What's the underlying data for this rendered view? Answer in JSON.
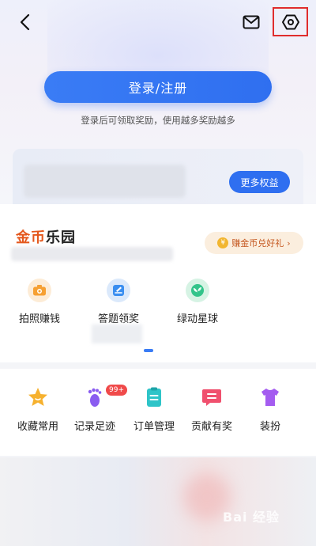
{
  "header": {
    "back_icon": "back-arrow-icon",
    "mail_icon": "mail-icon",
    "settings_icon": "settings-hexagon-icon",
    "highlight_color": "#e02d2d"
  },
  "login": {
    "button_label": "登录/注册",
    "subtitle": "登录后可领取奖励，使用越多奖励越多",
    "accent": "#2f6ff0"
  },
  "rights": {
    "more_label": "更多权益"
  },
  "coin_park": {
    "title_part1": "金币",
    "title_part2": "乐园",
    "exchange_coin_glyph": "¥",
    "exchange_label": "赚金币兑好礼",
    "exchange_chevron": "›",
    "features": [
      {
        "label": "拍照赚钱",
        "icon": "camera-icon",
        "color": "#f6a032"
      },
      {
        "label": "答题领奖",
        "icon": "quiz-icon",
        "color": "#3a8ef0"
      },
      {
        "label": "绿动星球",
        "icon": "leaf-planet-icon",
        "color": "#32c48a"
      }
    ]
  },
  "tools": {
    "items": [
      {
        "label": "收藏常用",
        "icon": "star-icon",
        "color": "#f6b12e"
      },
      {
        "label": "记录足迹",
        "icon": "footprint-icon",
        "color": "#8a5cf0"
      },
      {
        "label": "订单管理",
        "icon": "clipboard-icon",
        "color": "#2ec4c8"
      },
      {
        "label": "贡献有奖",
        "icon": "message-icon",
        "color": "#f0506e"
      },
      {
        "label": "装扮",
        "icon": "shirt-icon",
        "color": "#a45cf0"
      }
    ],
    "footprint_badge": "99+"
  },
  "watermark": "Bai 经验"
}
